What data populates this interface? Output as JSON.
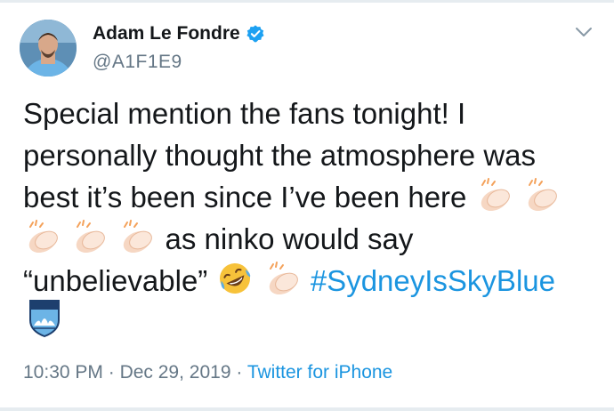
{
  "author": {
    "display_name": "Adam Le Fondre",
    "handle": "@A1F1E9",
    "verified_icon": "verified-badge-icon",
    "avatar": "profile-photo"
  },
  "tweet": {
    "line1": "Special mention the fans tonight! I",
    "line2": "personally thought the atmosphere was",
    "line3": "best it’s been since I’ve been here",
    "line4": "as ninko would say",
    "line5_text": "“unbelievable”",
    "hashtag": "#SydneyIsSkyBlue",
    "emojis": [
      "clapping-hands-icon",
      "rolling-on-floor-laughing-icon"
    ]
  },
  "meta": {
    "time": "10:30 PM",
    "separator": "·",
    "date": "Dec 29, 2019",
    "source": "Twitter for iPhone"
  },
  "colors": {
    "link": "#1b95e0",
    "secondary_text": "#657786",
    "primary_text": "#14171a"
  }
}
